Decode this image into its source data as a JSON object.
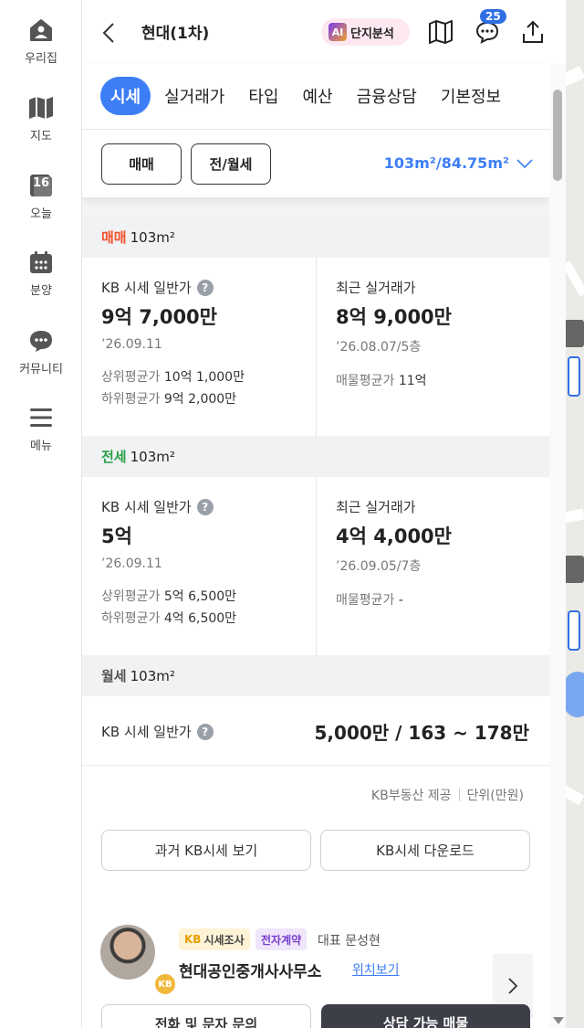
{
  "nav": {
    "items": [
      {
        "label": "우리집",
        "icon": "home-icon"
      },
      {
        "label": "지도",
        "icon": "map-icon"
      },
      {
        "label": "오늘",
        "icon": "calendar-today-icon",
        "day": "16"
      },
      {
        "label": "분양",
        "icon": "calendar-icon"
      },
      {
        "label": "커뮤니티",
        "icon": "chat-icon"
      },
      {
        "label": "메뉴",
        "icon": "menu-icon"
      }
    ]
  },
  "header": {
    "title": "현대(1차)",
    "ai_badge": "AI",
    "ai_label": "단지분석",
    "notification_count": "25"
  },
  "tabs": [
    "시세",
    "실거래가",
    "타입",
    "예산",
    "금융상담",
    "기본정보"
  ],
  "segments": {
    "sale": "매매",
    "rent": "전/월세"
  },
  "area_selector": "103m²/84.75m²",
  "sale": {
    "kind": "매매",
    "area": "103m²",
    "kb_label": "KB 시세 일반가",
    "kb_price": "9억 7,000만",
    "kb_date": "’26.09.11",
    "upper_label": "상위평균가",
    "upper_value": "10억 1,000만",
    "lower_label": "하위평균가",
    "lower_value": "9억 2,000만",
    "recent_label": "최근 실거래가",
    "recent_price": "8억 9,000만",
    "recent_date": "’26.08.07/5층",
    "listing_label": "매물평균가",
    "listing_value": "11억"
  },
  "jeonse": {
    "kind": "전세",
    "area": "103m²",
    "kb_label": "KB 시세 일반가",
    "kb_price": "5억",
    "kb_date": "’26.09.11",
    "upper_label": "상위평균가",
    "upper_value": "5억 6,500만",
    "lower_label": "하위평균가",
    "lower_value": "4억 6,500만",
    "recent_label": "최근 실거래가",
    "recent_price": "4억 4,000만",
    "recent_date": "’26.09.05/7층",
    "listing_label": "매물평균가",
    "listing_value": "-"
  },
  "monthly": {
    "kind": "월세",
    "area": "103m²",
    "kb_label": "KB 시세 일반가",
    "value": "5,000만 / 163 ~ 178만"
  },
  "source": {
    "provider": "KB부동산 제공",
    "unit": "단위(만원)"
  },
  "buttons": {
    "history": "과거 KB시세 보기",
    "download": "KB시세 다운로드"
  },
  "agent": {
    "tag_kb": "KB",
    "tag_survey": "시세조사",
    "tag_contract": "전자계약",
    "rep": "대표 문성현",
    "name": "현대공인중개사사무소",
    "location_link": "위치보기",
    "medal": "KB",
    "call_button": "전화 및 문자 문의",
    "listing_button": "상담 가능 매물"
  },
  "colors": {
    "accent": "#3d7ef6",
    "sale": "#f0502a",
    "jeonse": "#2aa04a",
    "monthly": "#555555"
  }
}
